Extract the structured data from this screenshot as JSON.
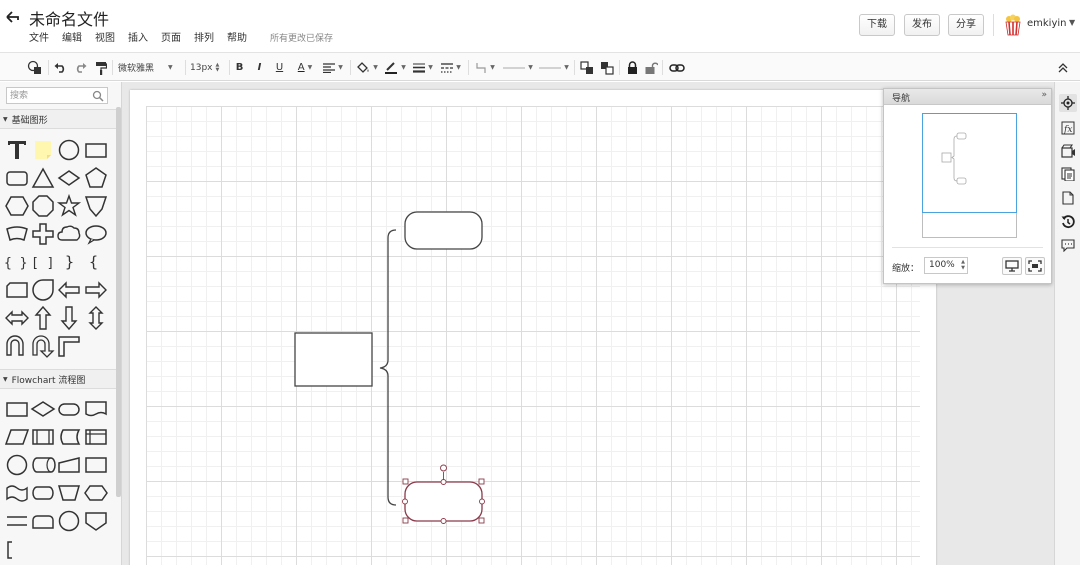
{
  "app": {
    "title": "未命名文件",
    "save_status": "所有更改已保存"
  },
  "menu": [
    "文件",
    "编辑",
    "视图",
    "插入",
    "页面",
    "排列",
    "帮助"
  ],
  "header_buttons": {
    "download": "下载",
    "publish": "发布",
    "share": "分享"
  },
  "user": {
    "name": "emkiyin"
  },
  "toolbar": {
    "font_family": "微软雅黑",
    "font_size": "13px",
    "bold": "B",
    "italic": "I",
    "underline": "U",
    "font_color": "A"
  },
  "left_panel": {
    "search_placeholder": "搜索",
    "categories": [
      {
        "label": "基础图形"
      },
      {
        "label": "Flowchart 流程图"
      }
    ]
  },
  "navigator": {
    "title": "导航",
    "zoom_label": "缩放：",
    "zoom_value": "100%"
  },
  "colors": {
    "accent": "#4aa3df",
    "selection": "#8b3a4a",
    "sticky_note": "#fff7b0"
  },
  "icons": [
    "back-arrow-icon",
    "search-icon",
    "popcorn-avatar-icon",
    "navigator-icon",
    "function-icon",
    "film-icon",
    "pages-icon",
    "page-icon",
    "history-icon",
    "comment-icon"
  ]
}
